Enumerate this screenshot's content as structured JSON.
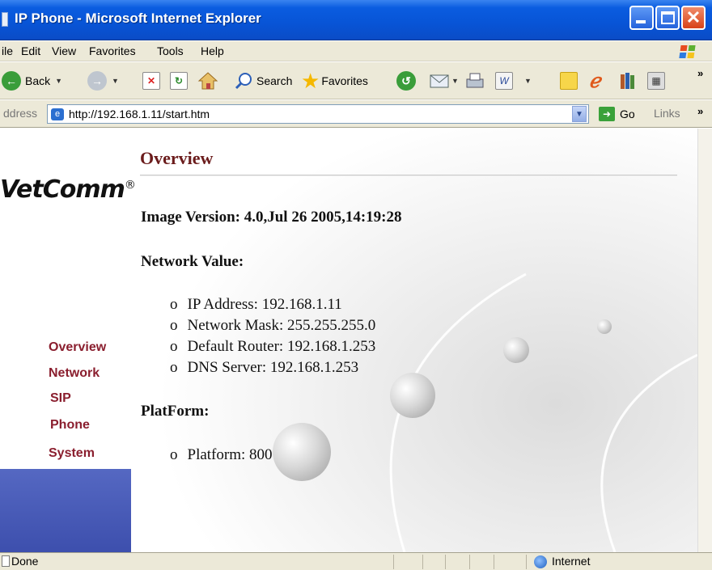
{
  "window": {
    "title": "IP Phone - Microsoft Internet Explorer",
    "accent": "#0a5ce0"
  },
  "menu": {
    "file": "ile",
    "edit": "Edit",
    "view": "View",
    "favorites": "Favorites",
    "tools": "Tools",
    "help": "Help"
  },
  "toolbar": {
    "back": "Back",
    "search": "Search",
    "favorites": "Favorites"
  },
  "address": {
    "label": "ddress",
    "url": "http://192.168.1.11/start.htm",
    "go": "Go",
    "links": "Links"
  },
  "sidebar": {
    "logo": "VetComm",
    "logo_mark": "®",
    "nav": [
      {
        "label": "Overview"
      },
      {
        "label": "Network"
      },
      {
        "label": "SIP"
      },
      {
        "label": "Phone"
      },
      {
        "label": "System"
      }
    ],
    "nav_color": "#8a1e2e"
  },
  "main": {
    "title": "Overview",
    "image_version": "Image Version: 4.0,Jul 26 2005,14:19:28",
    "network_heading": "Network Value:",
    "network": [
      {
        "bullet": "o",
        "text": "IP Address: 192.168.1.11"
      },
      {
        "bullet": "o",
        "text": "Network Mask: 255.255.255.0"
      },
      {
        "bullet": "o",
        "text": "Default Router: 192.168.1.253"
      },
      {
        "bullet": "o",
        "text": "DNS Server: 192.168.1.253"
      }
    ],
    "platform_heading": "PlatForm:",
    "platform": [
      {
        "bullet": "o",
        "text": "Platform: 800"
      }
    ]
  },
  "status": {
    "text": "Done",
    "zone": "Internet"
  }
}
